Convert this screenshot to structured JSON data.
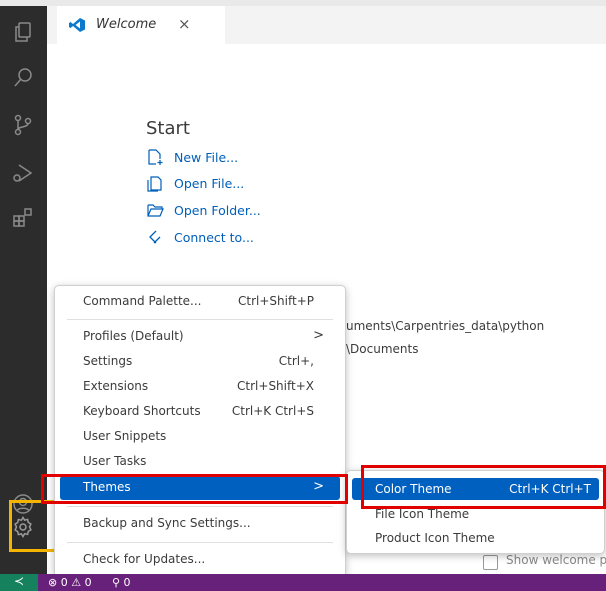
{
  "tab": {
    "title": "Welcome",
    "close": "×"
  },
  "start": {
    "heading": "Start",
    "items": [
      {
        "label": "New File...",
        "icon": "new-file-icon"
      },
      {
        "label": "Open File...",
        "icon": "open-file-icon"
      },
      {
        "label": "Open Folder...",
        "icon": "open-folder-icon"
      },
      {
        "label": "Connect to...",
        "icon": "remote-connect-icon"
      }
    ]
  },
  "recent": {
    "paths": [
      "uments\\Carpentries_data\\python",
      "\\Documents"
    ]
  },
  "welcome_option": {
    "label": "Show welcome pa"
  },
  "menu": {
    "items": [
      {
        "label": "Command Palette...",
        "key": "Ctrl+Shift+P"
      },
      {
        "label": "Profiles (Default)",
        "arrow": ">"
      },
      {
        "label": "Settings",
        "key": "Ctrl+,"
      },
      {
        "label": "Extensions",
        "key": "Ctrl+Shift+X"
      },
      {
        "label": "Keyboard Shortcuts",
        "key": "Ctrl+K Ctrl+S"
      },
      {
        "label": "User Snippets"
      },
      {
        "label": "User Tasks"
      },
      {
        "label": "Themes",
        "arrow": ">"
      },
      {
        "label": "Backup and Sync Settings..."
      },
      {
        "label": "Check for Updates..."
      }
    ]
  },
  "submenu": {
    "items": [
      {
        "label": "Color Theme",
        "key": "Ctrl+K Ctrl+T"
      },
      {
        "label": "File Icon Theme"
      },
      {
        "label": "Product Icon Theme"
      }
    ]
  },
  "statusbar": {
    "remote": "≺",
    "problems": "⊗ 0 ⚠ 0",
    "ports": "⚲ 0"
  },
  "colors": {
    "activity_bar": "#2c2c2c",
    "status_bar": "#68217a",
    "accent": "#0060c0",
    "link": "#005fb8",
    "highlight_red": "#e00000",
    "highlight_yellow": "#f4b400"
  }
}
